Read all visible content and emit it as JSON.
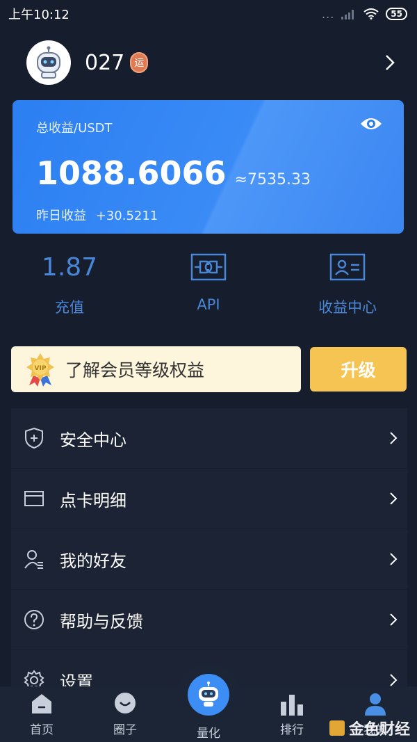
{
  "status_bar": {
    "time": "上午10:12",
    "dots": "...",
    "battery": "55"
  },
  "profile": {
    "username": "027",
    "level_badge": "运"
  },
  "card": {
    "label": "总收益/USDT",
    "amount": "1088.6066",
    "approx": "≈7535.33",
    "yesterday_label": "昨日收益",
    "yesterday_value": "+30.5211"
  },
  "quick": {
    "recharge": {
      "value": "1.87",
      "label": "充值"
    },
    "api": {
      "label": "API"
    },
    "earnings_center": {
      "label": "收益中心"
    }
  },
  "vip": {
    "text": "了解会员等级权益",
    "upgrade_label": "升级"
  },
  "menu": [
    {
      "label": "安全中心",
      "icon": "shield-icon"
    },
    {
      "label": "点卡明细",
      "icon": "card-icon"
    },
    {
      "label": "我的好友",
      "icon": "friends-icon"
    },
    {
      "label": "帮助与反馈",
      "icon": "help-icon"
    },
    {
      "label": "设置",
      "icon": "gear-icon"
    }
  ],
  "tabs": [
    {
      "label": "首页"
    },
    {
      "label": "圈子"
    },
    {
      "label": "量化"
    },
    {
      "label": "排行"
    },
    {
      "label": "我的"
    }
  ],
  "watermark": "金色财经",
  "colors": {
    "accent": "#3d8ef4",
    "card": "#2c7ff2",
    "upgrade": "#f6c453",
    "background": "#161e2e"
  }
}
